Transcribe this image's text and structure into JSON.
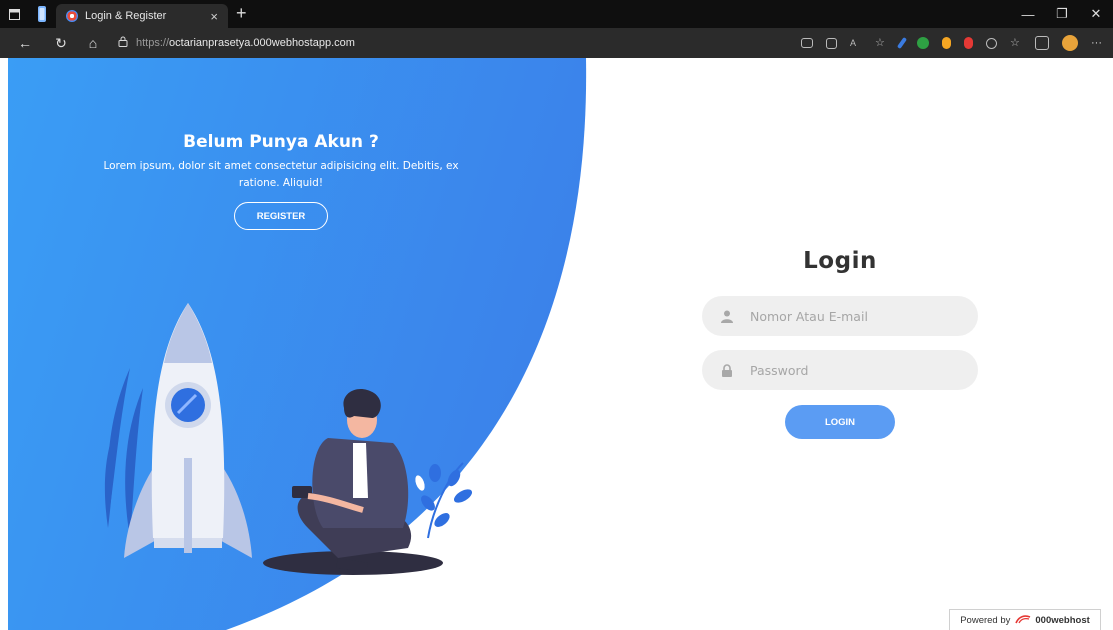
{
  "browser": {
    "tab_title": "Login & Register",
    "tab_close": "×",
    "new_tab": "+",
    "url_protocol": "https://",
    "url_host": "octarianprasetya.000webhostapp.com",
    "window_controls": {
      "minimize": "—",
      "restore": "❐",
      "close": "✕"
    },
    "nav": {
      "back": "←",
      "refresh": "↻",
      "home": "⌂"
    },
    "more": "···"
  },
  "page": {
    "register_panel": {
      "title": "Belum Punya Akun ?",
      "text": "Lorem ipsum, dolor sit amet consectetur adipisicing elit. Debitis, ex ratione. Aliquid!",
      "button_label": "REGISTER"
    },
    "login_form": {
      "title": "Login",
      "username_placeholder": "Nomor Atau E-mail",
      "password_placeholder": "Password",
      "button_label": "LOGIN"
    },
    "footer_badge": {
      "prefix": "Powered by",
      "brand": "000webhost"
    }
  },
  "colors": {
    "accent_blue": "#3d8ff0",
    "login_button": "#5b9cf3",
    "input_bg": "#efefef"
  }
}
